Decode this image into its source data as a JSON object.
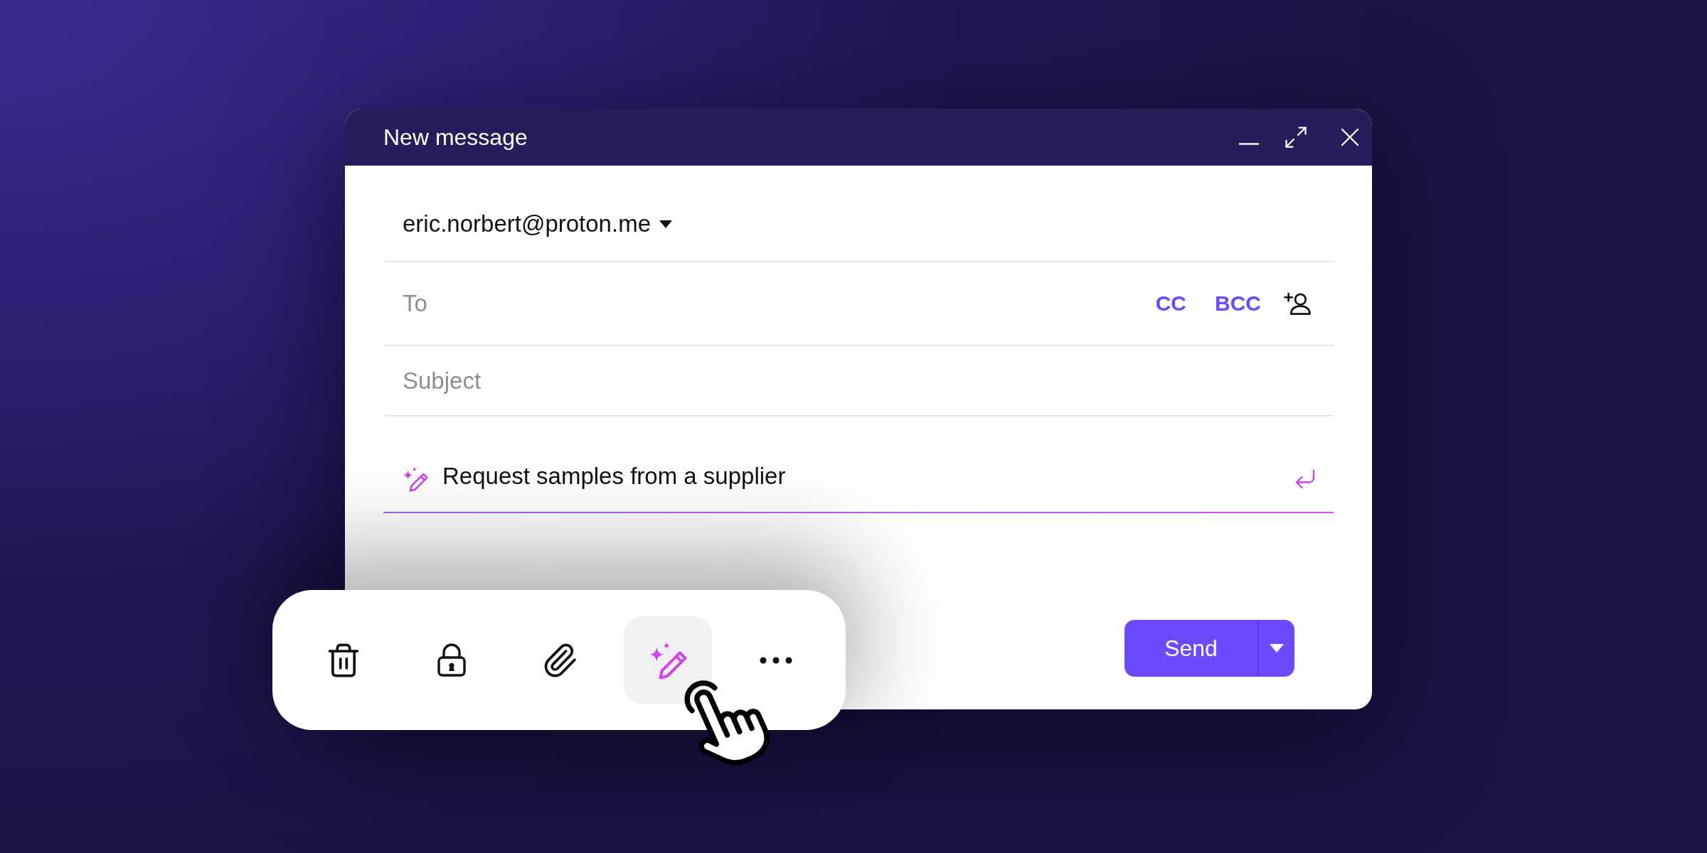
{
  "window": {
    "title": "New message"
  },
  "sender": {
    "address": "eric.norbert@proton.me"
  },
  "recipients": {
    "placeholder": "To",
    "links": [
      "CC",
      "BCC"
    ]
  },
  "subject": {
    "placeholder": "Subject"
  },
  "prompt": {
    "value": "Request samples from a supplier"
  },
  "send_button": {
    "label": "Send"
  },
  "toolbar": {
    "items": [
      {
        "kind": "delete",
        "selected": false
      },
      {
        "kind": "lock",
        "selected": false
      },
      {
        "kind": "attach",
        "selected": false
      },
      {
        "kind": "assistant",
        "selected": true
      },
      {
        "kind": "more",
        "selected": false
      }
    ]
  }
}
